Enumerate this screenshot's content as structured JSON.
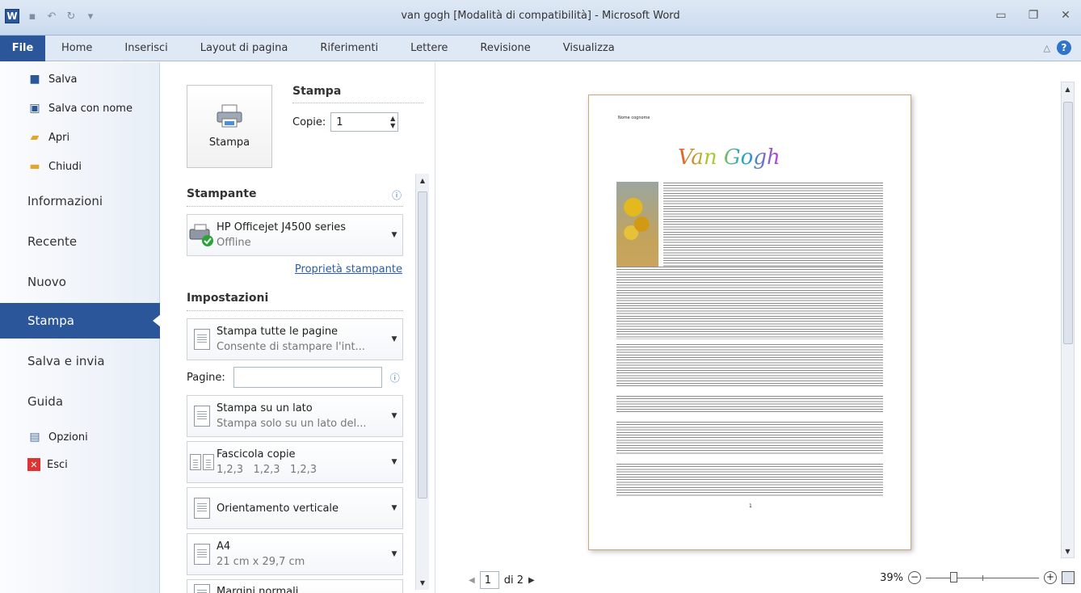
{
  "window": {
    "title": "van gogh [Modalità di compatibilità] - Microsoft Word",
    "app_icon_letter": "W"
  },
  "ribbon": {
    "tabs": [
      "File",
      "Home",
      "Inserisci",
      "Layout di pagina",
      "Riferimenti",
      "Lettere",
      "Revisione",
      "Visualizza"
    ]
  },
  "nav": {
    "small_top": [
      "Salva",
      "Salva con nome",
      "Apri",
      "Chiudi"
    ],
    "big": [
      "Informazioni",
      "Recente",
      "Nuovo",
      "Stampa",
      "Salva e invia",
      "Guida"
    ],
    "active": "Stampa",
    "small_bottom": [
      "Opzioni",
      "Esci"
    ]
  },
  "print": {
    "button_label": "Stampa",
    "section_title": "Stampa",
    "copies_label": "Copie:",
    "copies_value": "1",
    "printer_heading": "Stampante",
    "printer_name": "HP Officejet J4500 series",
    "printer_status": "Offline",
    "printer_properties_link": "Proprietà stampante",
    "settings_heading": "Impostazioni",
    "settings": [
      {
        "title": "Stampa tutte le pagine",
        "subtitle": "Consente di stampare l'int..."
      },
      {
        "title": "Stampa su un lato",
        "subtitle": "Stampa solo su un lato del..."
      },
      {
        "title": "Fascicola copie",
        "subtitle": "1,2,3   1,2,3   1,2,3"
      },
      {
        "title": "Orientamento verticale",
        "subtitle": ""
      },
      {
        "title": "A4",
        "subtitle": "21 cm x 29,7 cm"
      },
      {
        "title": "Margini normali",
        "subtitle": ""
      }
    ],
    "pages_label": "Pagine:",
    "pages_value": ""
  },
  "preview": {
    "header_text": "Nome cognome",
    "doc_title": "Van Gogh",
    "page_number_text": "1",
    "current_page": "1",
    "page_of": "di 2",
    "zoom": "39%"
  },
  "colors": {
    "accent": "#2b579a",
    "ribbon": "#dfe9f5"
  }
}
